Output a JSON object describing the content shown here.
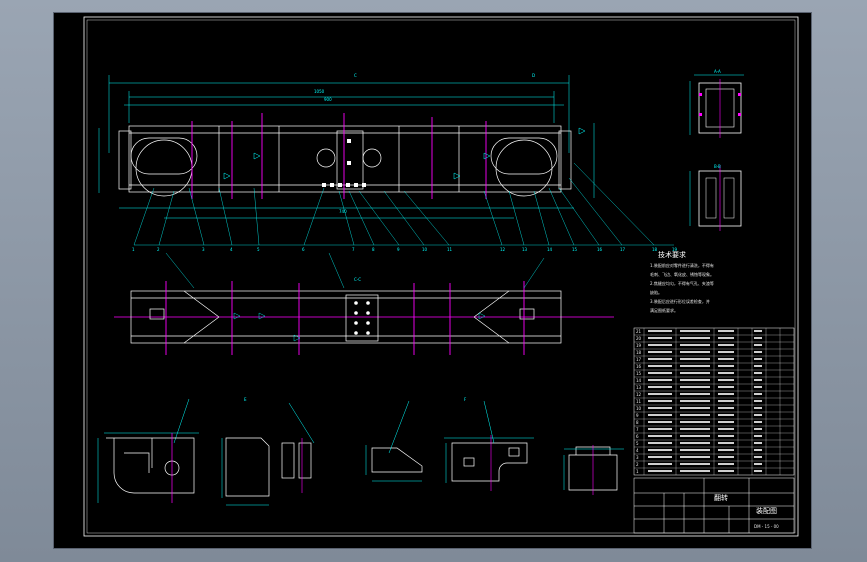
{
  "drawing": {
    "title_block": {
      "part_name": "翻转",
      "drawing_no": "装配图",
      "code": "DM - 15 - 00"
    },
    "technical_requirements": {
      "heading": "技术要求",
      "lines": [
        "1.装配前应对零件进行清洗，不得有",
        "毛刺、飞边、氧化皮、锈蚀等现象。",
        "2.焦缝应均匀，不得有气孔、夹渣等",
        "缺陷。",
        "3.装配后应进行形位误差检查，并",
        "满足图纸要求。"
      ]
    },
    "section_labels": [
      "A-A",
      "B-B",
      "C",
      "D",
      "E",
      "F"
    ],
    "balloons": [
      "1",
      "2",
      "3",
      "4",
      "5",
      "6",
      "7",
      "8",
      "9",
      "10",
      "11",
      "12",
      "13",
      "14",
      "15",
      "16",
      "17",
      "18",
      "19",
      "20",
      "21"
    ],
    "bom_rows": 21
  }
}
